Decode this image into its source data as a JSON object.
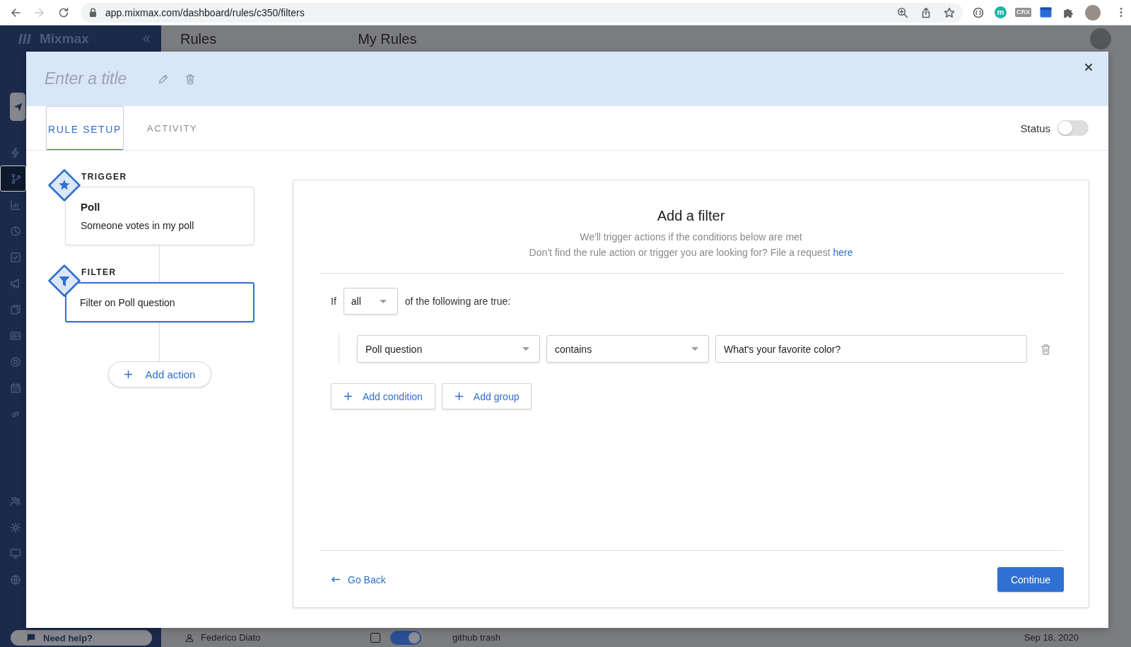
{
  "browser": {
    "nav": [
      {
        "kind": "back",
        "disabled": false
      },
      {
        "kind": "forward",
        "disabled": true
      },
      {
        "kind": "reload",
        "disabled": false
      }
    ],
    "url": "app.mixmax.com/dashboard/rules/c350/filters",
    "extensions": [
      {
        "kind": "ring"
      },
      {
        "kind": "letter",
        "label": "m"
      },
      {
        "kind": "tag",
        "label": "CRX"
      },
      {
        "kind": "square"
      },
      {
        "kind": "puzzle"
      }
    ]
  },
  "background": {
    "logo": "Mixmax",
    "sidebar": {
      "items": [
        {
          "selected": false
        },
        {
          "selected": true
        },
        {
          "selected": false
        },
        {
          "selected": false
        },
        {
          "selected": false
        },
        {
          "selected": false
        },
        {
          "selected": false
        },
        {
          "selected": false
        },
        {
          "selected": false
        },
        {
          "selected": false
        },
        {
          "selected": false
        },
        {
          "selected": false
        },
        {
          "selected": false
        },
        {
          "selected": false
        },
        {
          "selected": false
        }
      ]
    },
    "page_title": "Rules",
    "section_title": "My Rules",
    "help_button": "Need help?",
    "owner": "Federico Diato",
    "rule": {
      "checked": false,
      "on": true,
      "name": "github trash",
      "date": "Sep 18, 2020"
    }
  },
  "modal": {
    "title": {
      "placeholder": "Enter a title"
    },
    "tabs": [
      {
        "label": "RULE SETUP",
        "selected": true
      },
      {
        "label": "ACTIVITY",
        "selected": false
      }
    ],
    "status": {
      "label": "Status",
      "on": false
    },
    "flow": {
      "nodes": [
        {
          "kind": "trigger",
          "label": "TRIGGER",
          "title": "Poll",
          "description": "Someone votes in my poll",
          "selected": false
        },
        {
          "kind": "filter",
          "label": "FILTER",
          "description": "Filter on Poll question",
          "selected": true
        }
      ],
      "add_action": "Add action"
    },
    "filter": {
      "heading": "Add a filter",
      "subtitle": "We'll trigger actions if the conditions below are met",
      "request_text": "Don't find the rule action or trigger you are looking for? File a request",
      "request_link": "here",
      "if_label": "If",
      "match": "all",
      "match_suffix": "of the following are true:",
      "conditions": [
        {
          "field": "Poll question",
          "operator": "contains",
          "value": "What's your favorite color?"
        }
      ],
      "actions": [
        "Add condition",
        "Add group"
      ]
    },
    "footer": {
      "back": "Go Back",
      "continue": "Continue"
    }
  }
}
